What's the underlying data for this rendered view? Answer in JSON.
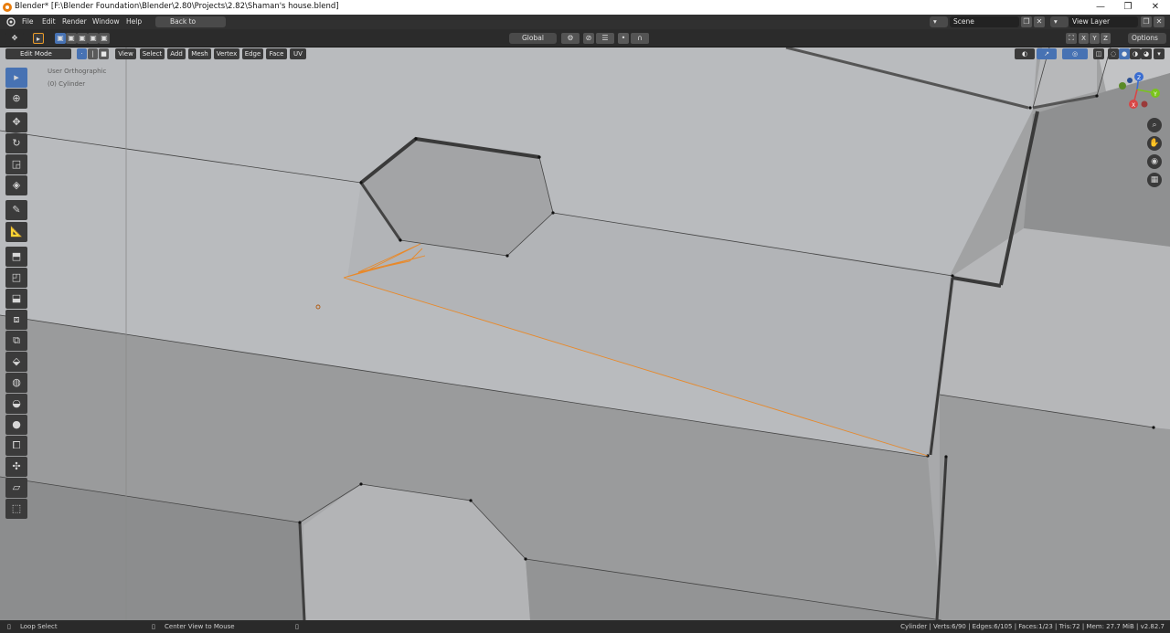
{
  "title_bar": {
    "title": "Blender* [F:\\Blender Foundation\\Blender\\2.80\\Projects\\2.82\\Shaman's house.blend]",
    "minimize": "—",
    "restore": "❐",
    "close": "✕"
  },
  "menu": {
    "items": [
      "File",
      "Edit",
      "Render",
      "Window",
      "Help"
    ],
    "back_button": "Back to Previous",
    "scene_label": "Scene",
    "view_layer_label": "View Layer"
  },
  "header": {
    "orientation": "Global",
    "axes": [
      "X",
      "Y",
      "Z"
    ],
    "options": "Options"
  },
  "editbar": {
    "mode": "Edit Mode",
    "menus": [
      "View",
      "Select",
      "Add",
      "Mesh",
      "Vertex",
      "Edge",
      "Face",
      "UV"
    ]
  },
  "viewport": {
    "view_name": "User Orthographic",
    "object_name": "(0) Cylinder",
    "gizmo_axes": [
      "Z",
      "Y",
      "X"
    ]
  },
  "tools": {
    "icons": [
      "select-box-icon",
      "cursor-icon",
      "move-icon",
      "rotate-icon",
      "scale-icon",
      "transform-icon",
      "annotate-icon",
      "measure-icon",
      "extrude-icon",
      "inset-icon",
      "bevel-icon",
      "loop-cut-icon",
      "offset-loop-icon",
      "knife-icon",
      "poly-build-icon",
      "spin-icon",
      "smooth-icon",
      "edge-slide-icon",
      "shrink-fatten-icon",
      "shear-icon",
      "rip-icon"
    ]
  },
  "status": {
    "left_action": "Loop Select",
    "middle_action": "Center View to Mouse",
    "stats": "Cylinder | Verts:6/90 | Edges:6/105 | Faces:1/23 | Tris:72 | Mem: 27.7 MiB | v2.82.7"
  },
  "colors": {
    "accent": "#4772b3",
    "selection": "#e8892a",
    "face_light": "#b5b7ba",
    "face_mid": "#9d9d9d"
  }
}
